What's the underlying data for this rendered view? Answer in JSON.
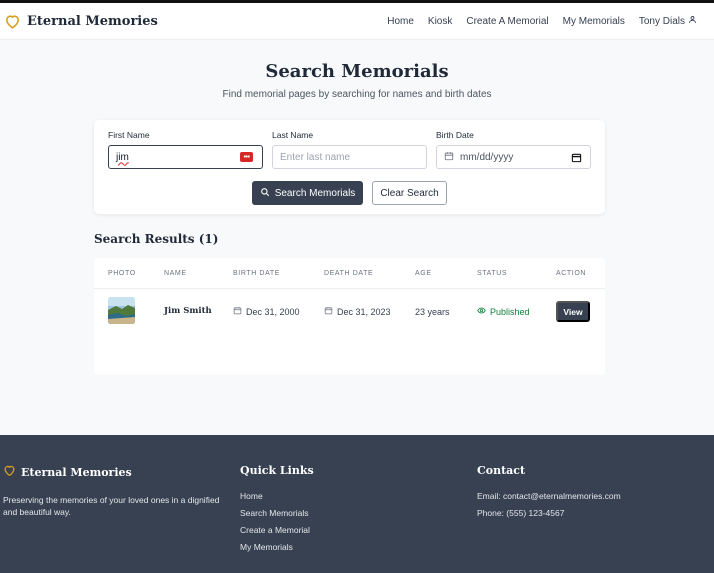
{
  "colors": {
    "accent": "#d4a017",
    "dark": "#374151",
    "success": "#15803d",
    "error": "#dc2626"
  },
  "header": {
    "brand": "Eternal Memories",
    "brand_icon": "heart-icon",
    "nav": {
      "home": "Home",
      "kiosk": "Kiosk",
      "create": "Create A Memorial",
      "my_memorials": "My Memorials",
      "user": "Tony Dials"
    },
    "user_icon": "user-icon"
  },
  "page": {
    "title": "Search Memorials",
    "subtitle": "Find memorial pages by searching for names and birth dates"
  },
  "search": {
    "first_name": {
      "label": "First Name",
      "value": "jim"
    },
    "last_name": {
      "label": "Last Name",
      "placeholder": "Enter last name"
    },
    "birth_date": {
      "label": "Birth Date",
      "placeholder": "mm/dd/yyyy"
    },
    "search_button": "Search Memorials",
    "clear_button": "Clear Search"
  },
  "results": {
    "title": "Search Results (1)",
    "columns": {
      "photo": "Photo",
      "name": "Name",
      "birth": "Birth Date",
      "death": "Death Date",
      "age": "Age",
      "status": "Status",
      "action": "Action"
    },
    "rows": [
      {
        "name": "Jim Smith",
        "birth_date": "Dec 31, 2000",
        "death_date": "Dec 31, 2023",
        "age": "23 years",
        "status": "Published",
        "action": "View"
      }
    ]
  },
  "footer": {
    "brand": "Eternal Memories",
    "tagline": "Preserving the memories of your loved ones in a dignified and beautiful way.",
    "quick_links_title": "Quick Links",
    "links": {
      "home": "Home",
      "search": "Search Memorials",
      "create": "Create a Memorial",
      "my": "My Memorials"
    },
    "contact_title": "Contact",
    "email": "Email: contact@eternalmemories.com",
    "phone": "Phone: (555) 123-4567"
  }
}
